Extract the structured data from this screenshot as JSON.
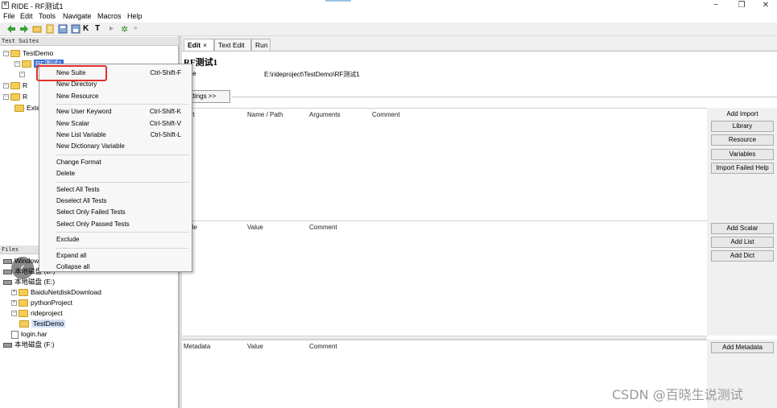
{
  "window": {
    "app_icon": "ride-app-icon",
    "title": "RIDE - RF测试1",
    "controls": {
      "minimize": "−",
      "restore": "❐",
      "close": "✕"
    }
  },
  "menubar": [
    "File",
    "Edit",
    "Tools",
    "Navigate",
    "Macros",
    "Help"
  ],
  "toolbar_icons": [
    "back-arrow-icon",
    "forward-arrow-icon",
    "open-folder-icon",
    "new-file-icon",
    "save-icon",
    "save-all-icon",
    "keyword-search-icon",
    "test-tag-search-icon",
    "run-icon",
    "settings-gear-icon",
    "stop-icon"
  ],
  "toolbar_glyphs": {
    "k": "K",
    "t": "T",
    "run": "▸",
    "gear": "✲",
    "stop": "●"
  },
  "test_suites": {
    "header": "Test Suites",
    "root": "TestDemo",
    "selected": "RF测试1",
    "partial_rows": [
      "R",
      "R"
    ],
    "ext": "Exte"
  },
  "files": {
    "header": "Files",
    "items": [
      {
        "label": "Windows",
        "kind": "drive",
        "indent": 0,
        "expander": ""
      },
      {
        "label": "本地磁盘 (D:)",
        "kind": "drive",
        "indent": 0,
        "expander": ""
      },
      {
        "label": "本地磁盘 (E:)",
        "kind": "drive",
        "indent": 0,
        "expander": ""
      },
      {
        "label": "BaiduNetdiskDownload",
        "kind": "folder",
        "indent": 1,
        "expander": "+"
      },
      {
        "label": "pythonProject",
        "kind": "folder",
        "indent": 1,
        "expander": "+"
      },
      {
        "label": "rideproject",
        "kind": "folder",
        "indent": 1,
        "expander": "−"
      },
      {
        "label": "TestDemo",
        "kind": "folder-selected",
        "indent": 2,
        "expander": ""
      },
      {
        "label": "login.har",
        "kind": "file",
        "indent": 1,
        "expander": ""
      },
      {
        "label": "本地磁盘 (F:)",
        "kind": "drive",
        "indent": 0,
        "expander": ""
      }
    ]
  },
  "context_menu": {
    "items": [
      {
        "label": "New Suite",
        "shortcut": "Ctrl-Shift-F"
      },
      {
        "label": "New Directory",
        "shortcut": ""
      },
      {
        "label": "New Resource",
        "shortcut": ""
      },
      {
        "sep": true
      },
      {
        "label": "New User Keyword",
        "shortcut": "Ctrl-Shift-K"
      },
      {
        "label": "New Scalar",
        "shortcut": "Ctrl-Shift-V"
      },
      {
        "label": "New List Variable",
        "shortcut": "Ctrl-Shift-L"
      },
      {
        "label": "New Dictionary Variable",
        "shortcut": ""
      },
      {
        "sep": true
      },
      {
        "label": "Change Format",
        "shortcut": ""
      },
      {
        "label": "Delete",
        "shortcut": ""
      },
      {
        "sep": true
      },
      {
        "label": "Select All Tests",
        "shortcut": ""
      },
      {
        "label": "Deselect All Tests",
        "shortcut": ""
      },
      {
        "label": "Select Only Failed Tests",
        "shortcut": ""
      },
      {
        "label": "Select Only Passed Tests",
        "shortcut": ""
      },
      {
        "sep": true
      },
      {
        "label": "Exclude",
        "shortcut": ""
      },
      {
        "sep": true
      },
      {
        "label": "Expand all",
        "shortcut": ""
      },
      {
        "label": "Collapse all",
        "shortcut": ""
      }
    ]
  },
  "tabs": [
    {
      "label": "Edit",
      "close": "×",
      "active": true
    },
    {
      "label": "Text Edit",
      "close": "",
      "active": false
    },
    {
      "label": "Run",
      "close": "",
      "active": false
    }
  ],
  "editor": {
    "title": "RF测试1",
    "source_label": "urce",
    "source_value": "E:\\rideproject\\TestDemo\\RF测试1",
    "settings_button": "ettings >>",
    "imports": {
      "columns": [
        "port",
        "Name / Path",
        "Arguments",
        "Comment"
      ],
      "side_title": "Add Import",
      "buttons": [
        "Library",
        "Resource",
        "Variables",
        "Import Failed Help"
      ]
    },
    "variables": {
      "columns": [
        "iable",
        "Value",
        "Comment"
      ],
      "buttons": [
        "Add Scalar",
        "Add List",
        "Add Dict"
      ]
    },
    "metadata": {
      "columns": [
        "Metadata",
        "Value",
        "Comment"
      ],
      "buttons": [
        "Add Metadata"
      ]
    }
  },
  "nav_back": "‹",
  "watermark": "CSDN @百晓生说测试",
  "colors": {
    "selection": "#3b6fd8",
    "highlight_box": "#e0312b",
    "folder": "#f3cd57"
  }
}
